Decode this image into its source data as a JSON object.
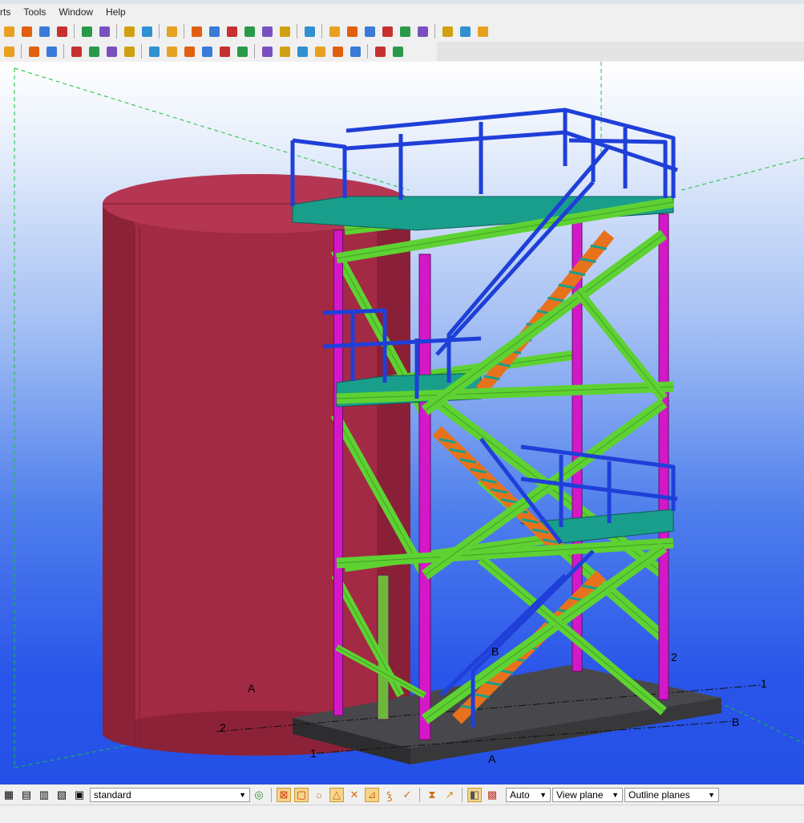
{
  "menu": {
    "items": [
      "rts",
      "Tools",
      "Window",
      "Help"
    ]
  },
  "colors": {
    "tank": "#a32a44",
    "column": "#d418c8",
    "beam": "#5ed232",
    "railing": "#1f3fd8",
    "stair": "#e8721c",
    "platform": "#1a9e8c",
    "slab": "#3f3f43"
  },
  "toolbar1": {
    "icons": [
      "new-model-icon",
      "open-model-icon",
      "save-model-icon",
      "save-as-icon",
      "undo-icon",
      "redo-icon",
      "copy-icon",
      "move-icon",
      "help-icon",
      "grid-icon",
      "frame-icon",
      "line-icon",
      "point-icon",
      "arc-icon",
      "fit-icon",
      "pick-icon",
      "select-parts-icon",
      "select-objects-icon",
      "properties-icon",
      "numbering-icon",
      "drawings-icon",
      "reports-icon",
      "arrows-icon",
      "folder-icon",
      "export-icon"
    ]
  },
  "toolbar2": {
    "icons": [
      "check-icon",
      "weld-icon",
      "bolt-icon",
      "binoculars-icon",
      "component-icon",
      "catalog-icon",
      "box-icon",
      "column-create-icon",
      "beam-create-icon",
      "plate-icon",
      "cut-icon",
      "fitting-icon",
      "connection-icon",
      "snap-end-icon",
      "snap-mid-icon",
      "snap-perp-icon",
      "snap-intersect-icon",
      "snap-near-icon",
      "snap-free-icon",
      "snap-line-icon",
      "snap-center-icon"
    ]
  },
  "viewport": {
    "grid_labels": [
      {
        "id": "grid-label-a-left",
        "text": "A"
      },
      {
        "id": "grid-label-2-left",
        "text": "2"
      },
      {
        "id": "grid-label-1-bottom",
        "text": "1"
      },
      {
        "id": "grid-label-a-bottom",
        "text": "A"
      },
      {
        "id": "grid-label-b-right",
        "text": "B"
      },
      {
        "id": "grid-label-1-right",
        "text": "1"
      },
      {
        "id": "grid-label-2-right",
        "text": "2"
      },
      {
        "id": "grid-label-b-center",
        "text": "B"
      }
    ]
  },
  "statusbar": {
    "standard_value": "standard",
    "auto_value": "Auto",
    "view_plane_value": "View plane",
    "outline_planes_value": "Outline planes"
  }
}
